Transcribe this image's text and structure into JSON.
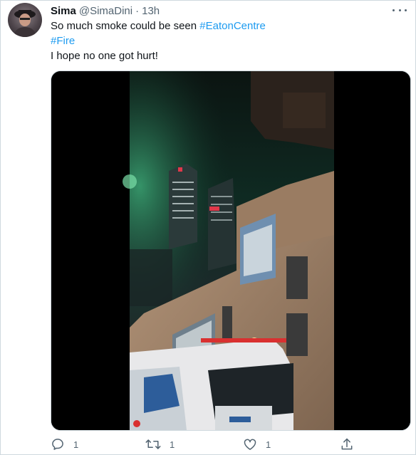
{
  "tweet": {
    "author_name": "Sima",
    "handle": "@SimaDini",
    "separator": "·",
    "time": "13h",
    "line1_text": "So much smoke could be seen ",
    "hashtag1": "#EatonCentre",
    "hashtag2": "#Fire",
    "line3_text": "I hope no one got hurt!",
    "media": {
      "type": "video",
      "description_icon": "video-thumbnail"
    },
    "actions": {
      "reply_count": "1",
      "retweet_count": "1",
      "like_count": "1"
    }
  },
  "colors": {
    "link": "#1d9bf0",
    "secondary_text": "#536471",
    "border": "#cfd9de"
  }
}
